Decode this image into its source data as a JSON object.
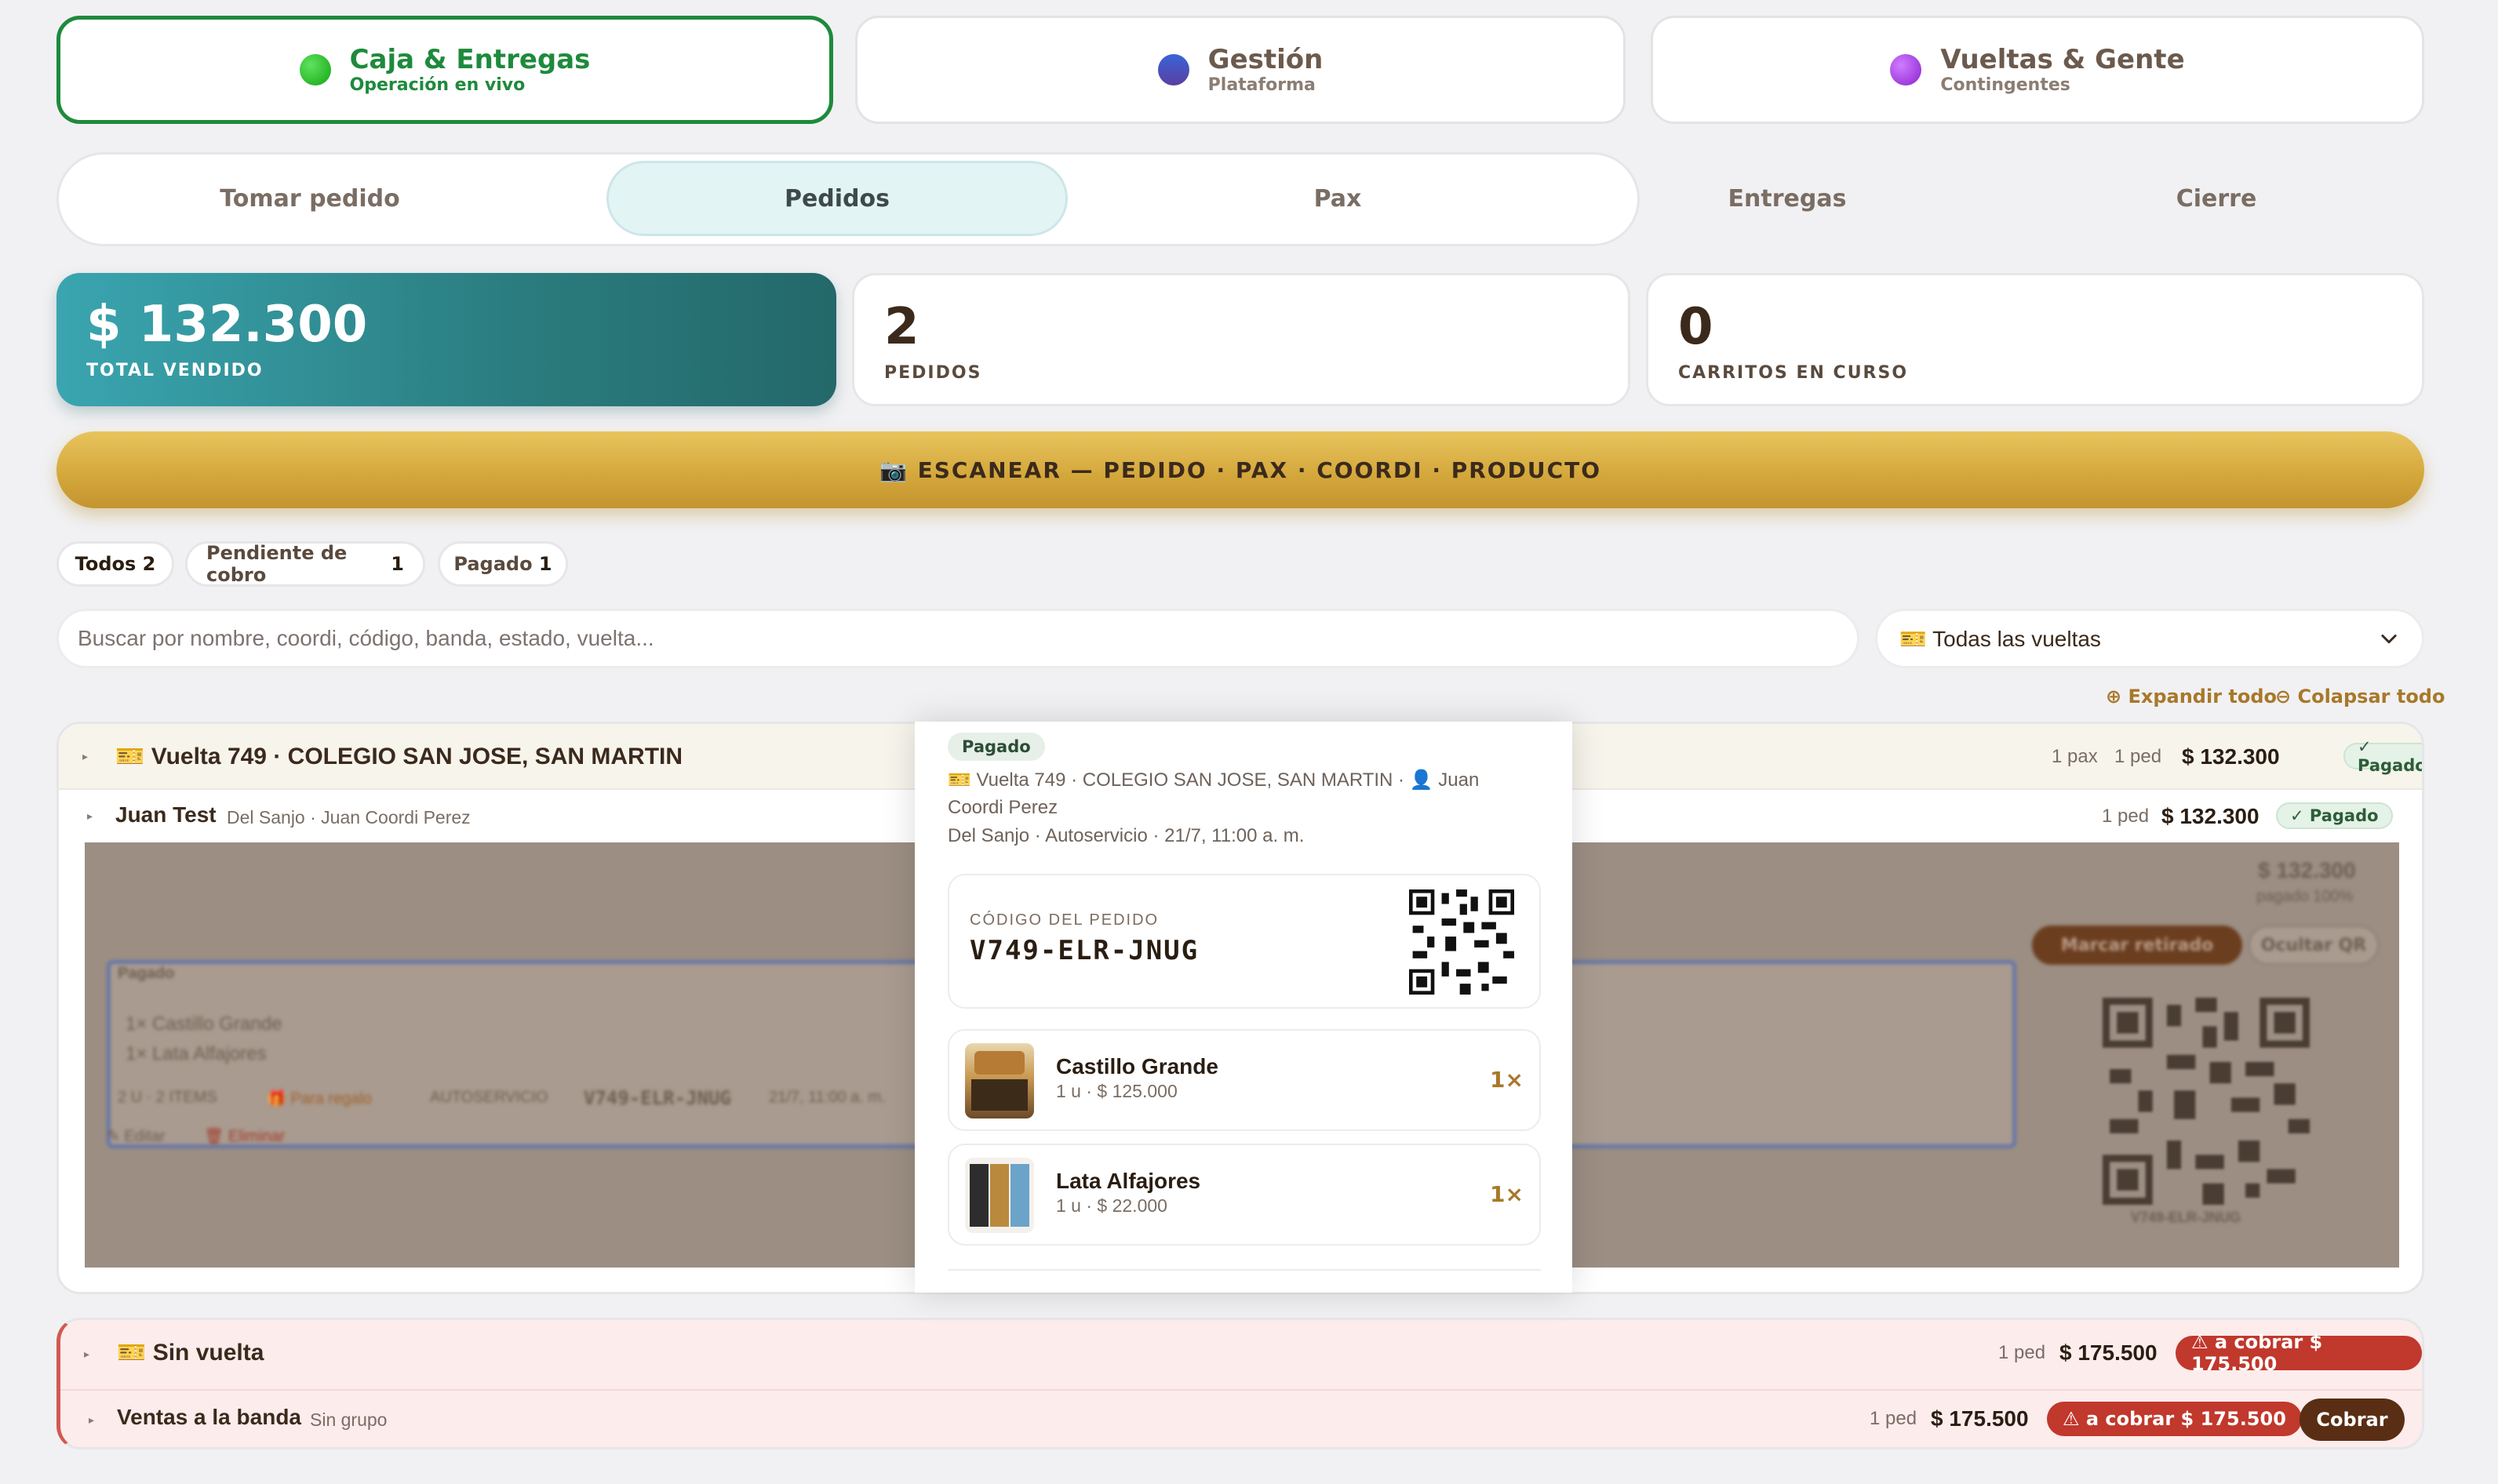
{
  "app_tabs": [
    {
      "title": "Caja & Entregas",
      "subtitle": "Operación en vivo",
      "active": true,
      "dot_color": "#1fb31f"
    },
    {
      "title": "Gestión",
      "subtitle": "Plataforma",
      "active": false,
      "dot_color": "#3d4fa8"
    },
    {
      "title": "Vueltas & Gente",
      "subtitle": "Contingentes",
      "active": false,
      "dot_color": "#a23fe0"
    }
  ],
  "sub_tabs": [
    {
      "label": "Tomar pedido",
      "active": false
    },
    {
      "label": "Pedidos",
      "active": true
    },
    {
      "label": "Pax",
      "active": false
    },
    {
      "label": "Entregas",
      "active": false
    },
    {
      "label": "Cierre",
      "active": false
    }
  ],
  "stats": [
    {
      "value": "$ 132.300",
      "label": "TOTAL VENDIDO"
    },
    {
      "value": "2",
      "label": "PEDIDOS"
    },
    {
      "value": "0",
      "label": "CARRITOS EN CURSO"
    }
  ],
  "scan_button": "📷 ESCANEAR — PEDIDO · PAX · COORDI · PRODUCTO",
  "filters": [
    {
      "label": "Todos",
      "count": "2"
    },
    {
      "label": "Pendiente de cobro",
      "count": "1"
    },
    {
      "label": "Pagado",
      "count": "1"
    }
  ],
  "search": {
    "placeholder": "Buscar por nombre, coordi, código, banda, estado, vuelta..."
  },
  "vuelta_select": {
    "value": "🎫 Todas las vueltas"
  },
  "expand_all": "⊕ Expandir todo",
  "collapse_all": "⊖ Colapsar todo",
  "groups": [
    {
      "title": "🎫 Vuelta 749 · COLEGIO SAN JOSE, SAN MARTIN",
      "pax": "1 pax",
      "peds": "1 ped",
      "amount": "$ 132.300",
      "status": "✓ Pagado",
      "person": {
        "name": "Juan Test",
        "detail": "Del Sanjo · Juan Coordi Perez",
        "peds": "1 ped",
        "amount": "$ 132.300",
        "status": "✓ Pagado"
      }
    },
    {
      "title": "🎫 Sin vuelta",
      "peds": "1 ped",
      "amount": "$ 175.500",
      "status": "⚠ a cobrar $ 175.500",
      "person": {
        "name": "Ventas a la banda",
        "detail": "Sin grupo",
        "peds": "1 ped",
        "amount": "$ 175.500",
        "status": "⚠ a cobrar $ 175.500",
        "action": "Cobrar"
      }
    }
  ],
  "backdrop": {
    "total": "$ 132.300",
    "paid": "pagado 100%",
    "mark_button": "Marcar retirado",
    "hide_qr": "Ocultar QR",
    "card_status": "Pagado",
    "line1": "1×  Castillo Grande",
    "line2": "1×  Lata Alfajores",
    "summary": "2 U · 2 ITEMS",
    "gift": "🎁 Para regalo",
    "mode": "AUTOSERVICIO",
    "code": "V749-ELR-JNUG",
    "date": "21/7, 11:00 a. m.",
    "edit": "✎ Editar",
    "delete": "🗑 Eliminar",
    "qr_code": "V749-ELR-JNUG"
  },
  "modal": {
    "status": "Pagado",
    "line1": "🎫 Vuelta 749 · COLEGIO SAN JOSE, SAN MARTIN · 👤 Juan",
    "line2": "Coordi Perez",
    "line3": "Del Sanjo · Autoservicio · 21/7, 11:00 a. m.",
    "code_label": "CÓDIGO DEL PEDIDO",
    "code": "V749-ELR-JNUG",
    "items": [
      {
        "name": "Castillo Grande",
        "detail": "1 u · $ 125.000",
        "qty": "1×"
      },
      {
        "name": "Lata Alfajores",
        "detail": "1 u · $ 22.000",
        "qty": "1×"
      }
    ]
  }
}
